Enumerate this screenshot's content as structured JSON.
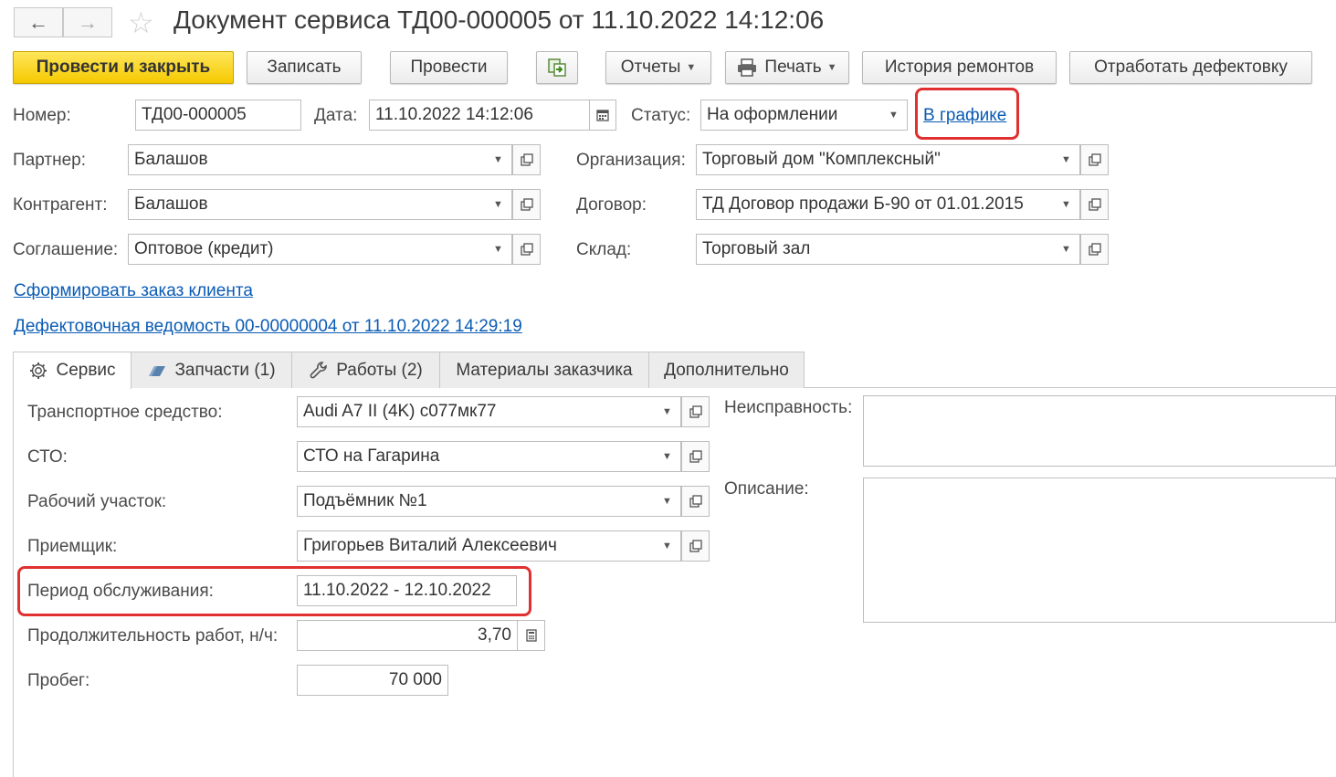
{
  "title": "Документ сервиса ТД00-000005 от 11.10.2022 14:12:06",
  "nav": {
    "back": "←",
    "forward": "→"
  },
  "toolbar": {
    "post_close": "Провести и закрыть",
    "save": "Записать",
    "post": "Провести",
    "reports": "Отчеты",
    "print": "Печать",
    "repair_history": "История ремонтов",
    "work_defects": "Отработать дефектовку"
  },
  "header": {
    "number_label": "Номер:",
    "number_value": "ТД00-000005",
    "date_label": "Дата:",
    "date_value": "11.10.2022 14:12:06",
    "status_label": "Статус:",
    "status_value": "На оформлении",
    "status_link": "В графике",
    "partner_label": "Партнер:",
    "partner_value": "Балашов",
    "counterparty_label": "Контрагент:",
    "counterparty_value": "Балашов",
    "agreement_label": "Соглашение:",
    "agreement_value": "Оптовое (кредит)",
    "organization_label": "Организация:",
    "organization_value": "Торговый дом \"Комплексный\"",
    "contract_label": "Договор:",
    "contract_value": "ТД Договор продажи Б-90 от 01.01.2015",
    "warehouse_label": "Склад:",
    "warehouse_value": "Торговый зал"
  },
  "links": {
    "create_order": "Сформировать заказ клиента",
    "defect_sheet": "Дефектовочная ведомость 00-00000004 от 11.10.2022 14:29:19"
  },
  "tabs": [
    {
      "label": "Сервис"
    },
    {
      "label": "Запчасти (1)"
    },
    {
      "label": "Работы (2)"
    },
    {
      "label": "Материалы заказчика"
    },
    {
      "label": "Дополнительно"
    }
  ],
  "service": {
    "vehicle_label": "Транспортное средство:",
    "vehicle_value": "Audi A7 II (4K) с077мк77",
    "sto_label": "СТО:",
    "sto_value": "СТО на Гагарина",
    "workplace_label": "Рабочий участок:",
    "workplace_value": "Подъёмник №1",
    "receiver_label": "Приемщик:",
    "receiver_value": "Григорьев Виталий Алексеевич",
    "period_label": "Период обслуживания:",
    "period_value": "11.10.2022 - 12.10.2022",
    "duration_label": "Продолжительность работ, н/ч:",
    "duration_value": "3,70",
    "mileage_label": "Пробег:",
    "mileage_value": "70 000",
    "malfunction_label": "Неисправность:",
    "description_label": "Описание:"
  },
  "colors": {
    "primary_button": "#f5c900",
    "link": "#0a5bb5",
    "highlight": "#e03030"
  }
}
